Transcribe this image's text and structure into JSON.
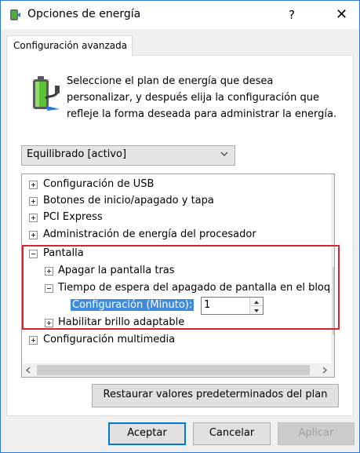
{
  "window": {
    "title": "Opciones de energía",
    "help_glyph": "?",
    "close_glyph": "✕"
  },
  "tab": {
    "label": "Configuración avanzada"
  },
  "description": {
    "line1": "Seleccione el plan de energía que desea",
    "line2": "personalizar, y después elija la configuración que",
    "line3": "refleje la forma deseada para administrar la energía."
  },
  "plan_select": {
    "value": "Equilibrado [activo]"
  },
  "tree": {
    "items": [
      {
        "label": "Configuración de USB"
      },
      {
        "label": "Botones de inicio/apagado y tapa"
      },
      {
        "label": "PCI Express"
      },
      {
        "label": "Administración de energía del procesador"
      },
      {
        "label": "Pantalla"
      },
      {
        "label": "Apagar la pantalla tras"
      },
      {
        "label": "Tiempo de espera del apagado de pantalla en el bloqueo de consola"
      },
      {
        "label": "Configuración (Minuto):"
      },
      {
        "label": "Habilitar brillo adaptable"
      },
      {
        "label": "Configuración multimedia"
      }
    ],
    "spinner_value": "1"
  },
  "buttons": {
    "restore": "Restaurar valores predeterminados del plan",
    "accept": "Aceptar",
    "cancel": "Cancelar",
    "apply": "Aplicar"
  },
  "colors": {
    "accent": "#0078d7",
    "selection": "#3f8bdc",
    "highlight_box": "#d9232e"
  }
}
